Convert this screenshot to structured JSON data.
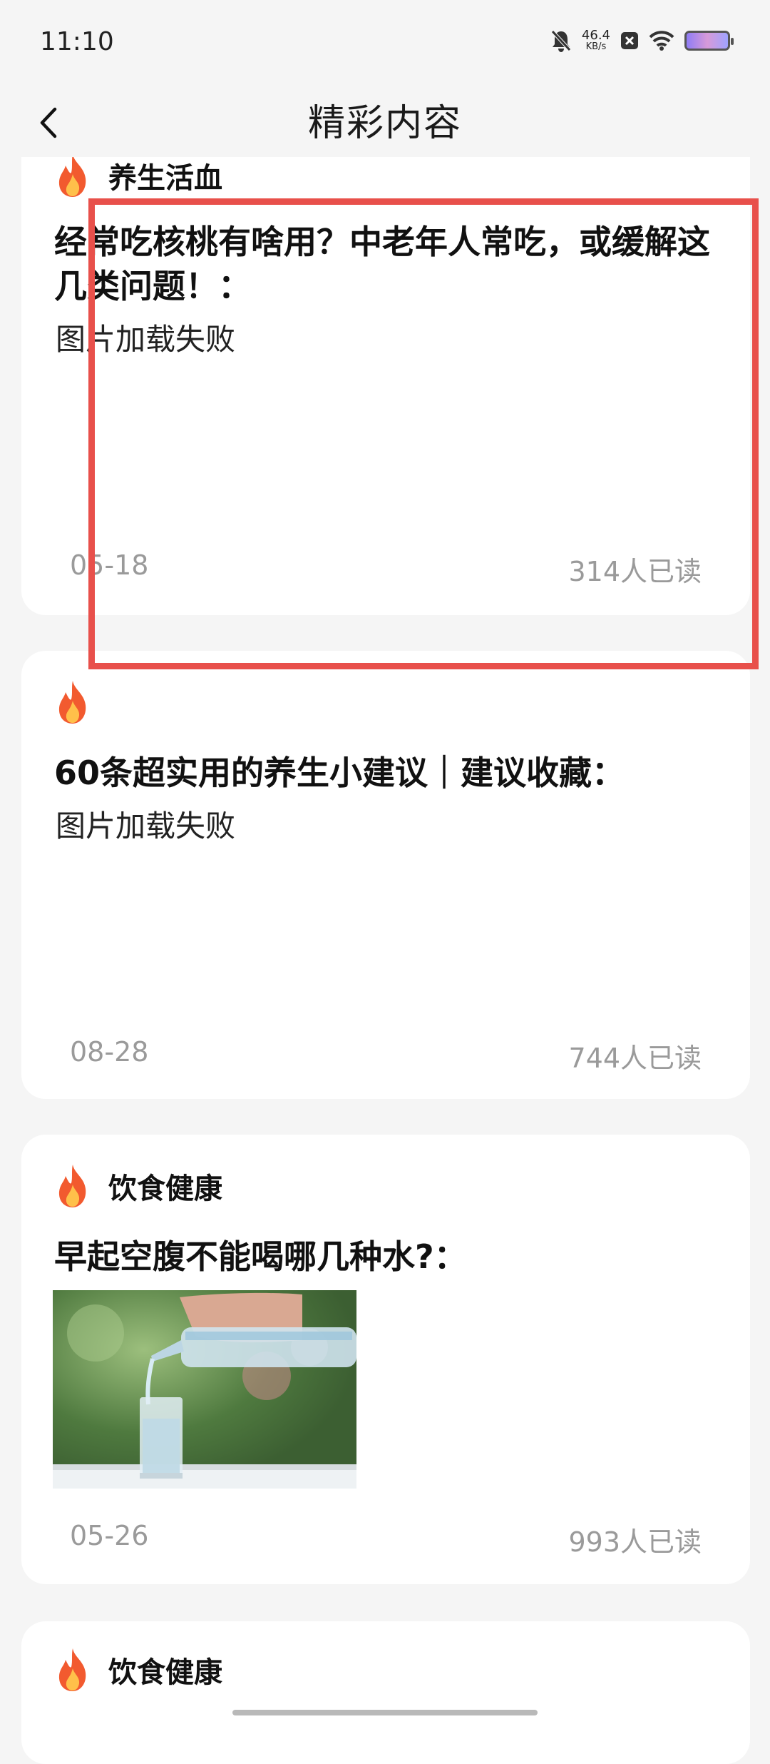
{
  "status_bar": {
    "time": "11:10",
    "net_speed_value": "46.4",
    "net_speed_unit": "KB/s",
    "icons": [
      "bell-off-icon",
      "close-box-icon",
      "wifi-icon",
      "battery-icon"
    ]
  },
  "nav": {
    "title": "精彩内容",
    "back_icon": "chevron-left-icon"
  },
  "cards": [
    {
      "tag": "养生活血",
      "title": "经常吃核桃有啥用？中老年人常吃，或缓解这几类问题！：",
      "image_text": "图片加载失败",
      "date": "05-18",
      "reads": "314人已读"
    },
    {
      "tag": "",
      "title": "60条超实用的养生小建议｜建议收藏：",
      "image_text": "图片加载失败",
      "date": "08-28",
      "reads": "744人已读"
    },
    {
      "tag": "饮食健康",
      "title": "早起空腹不能喝哪几种水?：",
      "image_text": "",
      "date": "05-26",
      "reads": "993人已读"
    },
    {
      "tag": "饮食健康"
    }
  ],
  "colors": {
    "background": "#f5f5f5",
    "card": "#ffffff",
    "highlight": "#e8504b",
    "muted_text": "#9a9a9a"
  }
}
